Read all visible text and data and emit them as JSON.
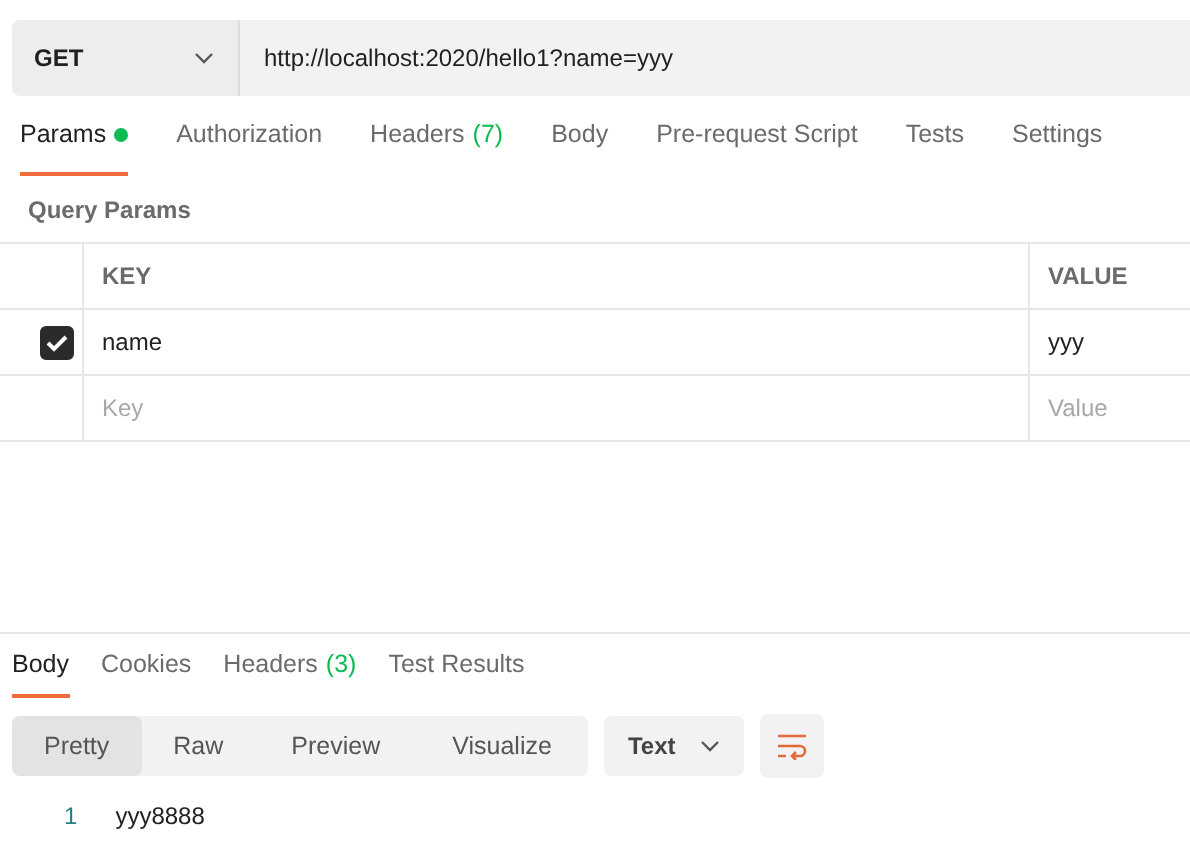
{
  "request": {
    "method": "GET",
    "url": "http://localhost:2020/hello1?name=yyy"
  },
  "request_tabs": [
    {
      "label": "Params",
      "dot": true,
      "selected": true
    },
    {
      "label": "Authorization",
      "selected": false
    },
    {
      "label": "Headers",
      "count": "(7)",
      "selected": false
    },
    {
      "label": "Body",
      "selected": false
    },
    {
      "label": "Pre-request Script",
      "selected": false
    },
    {
      "label": "Tests",
      "selected": false
    },
    {
      "label": "Settings",
      "selected": false
    }
  ],
  "query_params": {
    "title": "Query Params",
    "columns": [
      "KEY",
      "VALUE"
    ],
    "rows": [
      {
        "checked": true,
        "key": "name",
        "value": "yyy"
      }
    ],
    "new_row": {
      "key_placeholder": "Key",
      "value_placeholder": "Value"
    }
  },
  "response_tabs": [
    {
      "label": "Body",
      "selected": true
    },
    {
      "label": "Cookies",
      "selected": false
    },
    {
      "label": "Headers",
      "count": "(3)",
      "selected": false
    },
    {
      "label": "Test Results",
      "selected": false
    }
  ],
  "view_modes": [
    {
      "label": "Pretty",
      "selected": true
    },
    {
      "label": "Raw",
      "selected": false
    },
    {
      "label": "Preview",
      "selected": false
    },
    {
      "label": "Visualize",
      "selected": false
    }
  ],
  "format": "Text",
  "body_lines": [
    {
      "number": "1",
      "text": "yyy8888"
    }
  ]
}
